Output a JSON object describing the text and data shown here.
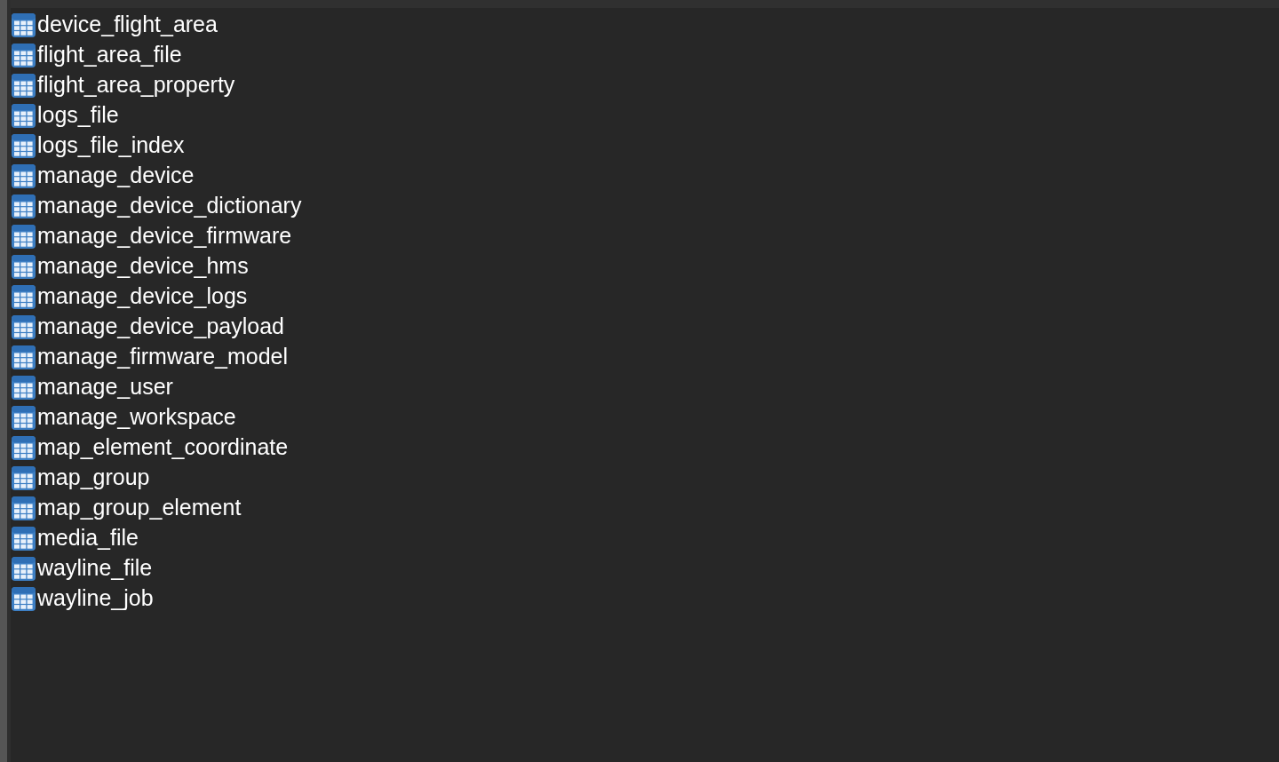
{
  "tables": [
    "device_flight_area",
    "flight_area_file",
    "flight_area_property",
    "logs_file",
    "logs_file_index",
    "manage_device",
    "manage_device_dictionary",
    "manage_device_firmware",
    "manage_device_hms",
    "manage_device_logs",
    "manage_device_payload",
    "manage_firmware_model",
    "manage_user",
    "manage_workspace",
    "map_element_coordinate",
    "map_group",
    "map_group_element",
    "media_file",
    "wayline_file",
    "wayline_job"
  ]
}
